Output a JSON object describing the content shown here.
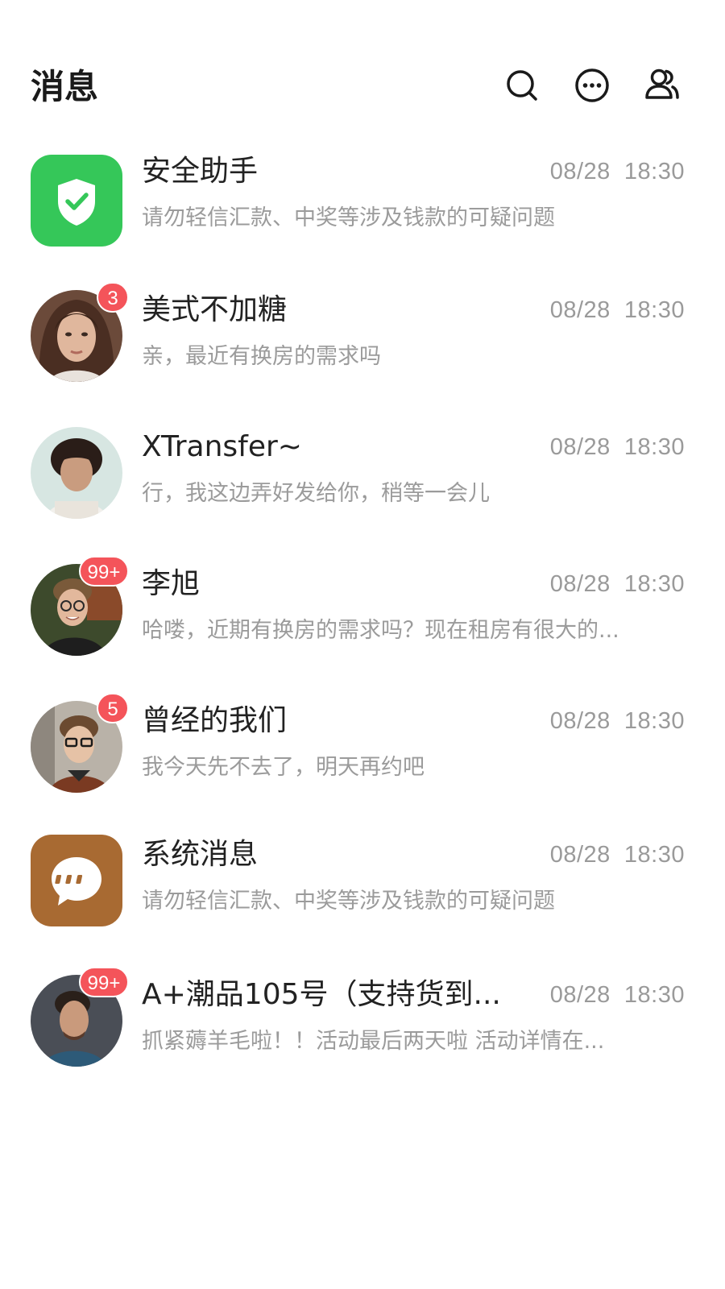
{
  "header": {
    "title": "消息",
    "icons": [
      "search-icon",
      "more-icon",
      "contacts-icon"
    ]
  },
  "colors": {
    "badge": "#f4545a",
    "security_bg": "#35c759",
    "system_bg": "#a86a32",
    "secondary_text": "#9b9b9b"
  },
  "conversations": [
    {
      "name": "安全助手",
      "time": "08/28  18:30",
      "preview": "请勿轻信汇款、中奖等涉及钱款的可疑问题",
      "avatar": "shield-check-icon",
      "badge": ""
    },
    {
      "name": "美式不加糖",
      "time": "08/28  18:30",
      "preview": "亲，最近有换房的需求吗",
      "avatar": "user-photo",
      "badge": "3"
    },
    {
      "name": "XTransfer~",
      "time": "08/28  18:30",
      "preview": "行，我这边弄好发给你，稍等一会儿",
      "avatar": "user-photo",
      "badge": ""
    },
    {
      "name": "李旭",
      "time": "08/28  18:30",
      "preview": "哈喽，近期有换房的需求吗？现在租房有很大的...",
      "avatar": "user-photo",
      "badge": "99+"
    },
    {
      "name": "曾经的我们",
      "time": "08/28  18:30",
      "preview": "我今天先不去了，明天再约吧",
      "avatar": "user-photo",
      "badge": "5"
    },
    {
      "name": "系统消息",
      "time": "08/28  18:30",
      "preview": "请勿轻信汇款、中奖等涉及钱款的可疑问题",
      "avatar": "chat-bubble-icon",
      "badge": ""
    },
    {
      "name": "A+潮品105号（支持货到...",
      "time": "08/28  18:30",
      "preview": "抓紧薅羊毛啦！！活动最后两天啦  活动详情在...",
      "avatar": "user-photo",
      "badge": "99+"
    }
  ]
}
